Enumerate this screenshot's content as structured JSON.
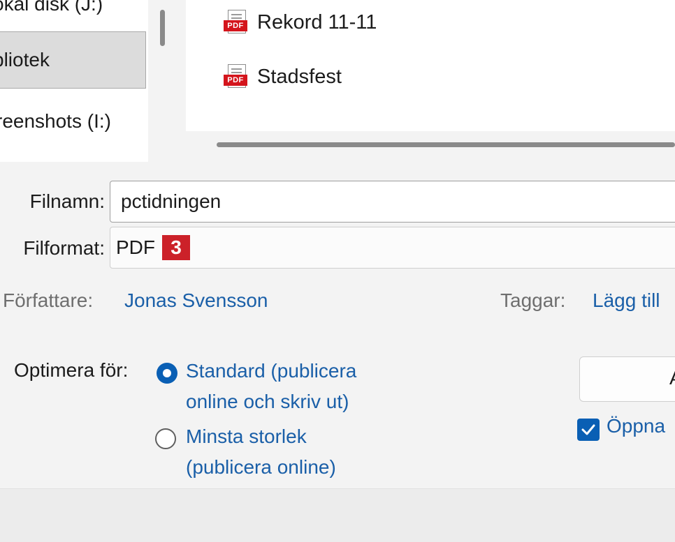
{
  "navigation": {
    "items": [
      {
        "label": "okal disk (J:)"
      },
      {
        "label": "bliotek"
      },
      {
        "label": "reenshots (I:)"
      }
    ]
  },
  "files": [
    {
      "name": "Rekord 11-11",
      "icon": "pdf-file-icon",
      "icon_text": "PDF"
    },
    {
      "name": "Stadsfest",
      "icon": "pdf-file-icon",
      "icon_text": "PDF"
    }
  ],
  "form": {
    "filename_label": "Filnamn:",
    "filename_value": "pctidningen",
    "format_label": "Filformat:",
    "format_value": "PDF",
    "step_badge": "3",
    "author_label": "Författare:",
    "author_value": "Jonas Svensson",
    "tags_label": "Taggar:",
    "tags_value": "Lägg till",
    "optimize_label": "Optimera för:",
    "options": [
      {
        "line1": "Standard (publicera",
        "line2": "online och skriv ut)",
        "selected": true
      },
      {
        "line1": "Minsta storlek",
        "line2": "(publicera online)",
        "selected": false
      }
    ],
    "options_button_label": "A",
    "open_after_label": "Öppna",
    "open_after_checked": true
  },
  "colors": {
    "accent": "#0a5fb4",
    "link": "#1a5fa8",
    "badge": "#cc2129",
    "pdf_red": "#d4151c"
  }
}
